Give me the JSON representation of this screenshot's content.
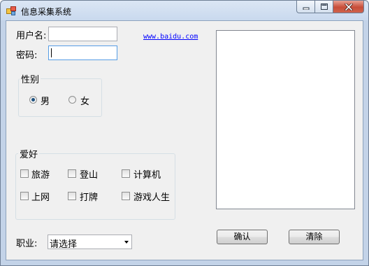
{
  "window": {
    "title": "信息采集系统",
    "icons": {
      "app": "app-icon",
      "minimize": "minimize-icon",
      "maximize": "maximize-icon",
      "close": "close-icon"
    }
  },
  "form": {
    "username_label": "用户名:",
    "username_value": "",
    "password_label": "密码:",
    "password_value": "",
    "link_text": "www.baidu.com",
    "gender": {
      "title": "性别",
      "options": [
        "男",
        "女"
      ],
      "selected": "男"
    },
    "hobbies": {
      "title": "爱好",
      "options": [
        "旅游",
        "登山",
        "计算机",
        "上网",
        "打牌",
        "游戏人生"
      ],
      "checked": []
    },
    "job": {
      "label": "职业:",
      "selected": "请选择"
    },
    "buttons": {
      "confirm": "确认",
      "clear": "清除"
    }
  },
  "colors": {
    "link": "#0000ff",
    "title_bar": "#c9d9ee",
    "close_button": "#c74d38",
    "client_bg": "#f0f0f0"
  }
}
